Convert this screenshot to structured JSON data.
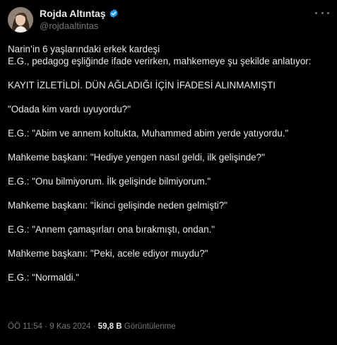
{
  "author": {
    "display_name": "Rojda Altıntaş",
    "handle": "@rojdaaltintas",
    "verified_color": "#1d9bf0"
  },
  "tweet": {
    "line1": "Narin’in 6 yaşlarındaki erkek kardeşi",
    "line2": "E.G., pedagog eşliğinde ifade verirken, mahkemeye şu şekilde anlatıyor:",
    "line3": "KAYIT İZLETİLDİ. DÜN AĞLADIĞI İÇİN İFADESİ ALINMAMIŞTI",
    "line4": "\"Odada kim vardı uyuyordu?\"",
    "line5": "E.G.: \"Abim ve annem koltukta, Muhammed abim yerde yatıyordu.\"",
    "line6": "Mahkeme başkanı: \"Hediye yengen nasıl geldi, ilk gelişinde?\"",
    "line7": "E.G.: \"Onu bilmiyorum. İlk gelişinde bilmiyorum.\"",
    "line8": "Mahkeme başkanı: \"İkinci gelişinde neden gelmişti?\"",
    "line9": "E.G.: \"Annem çamaşırları ona bırakmıştı, ondan.\"",
    "line10": "Mahkeme başkanı: \"Peki, acele ediyor muydu?\"",
    "line11": "E.G.: \"Normaldi.\""
  },
  "meta": {
    "time": "ÖÖ 11:54",
    "date": "9 Kas 2024",
    "views_count": "59,8 B",
    "views_label": "Görüntülenme"
  },
  "icons": {
    "more": "more-options-icon",
    "verified": "verified-badge-icon"
  }
}
